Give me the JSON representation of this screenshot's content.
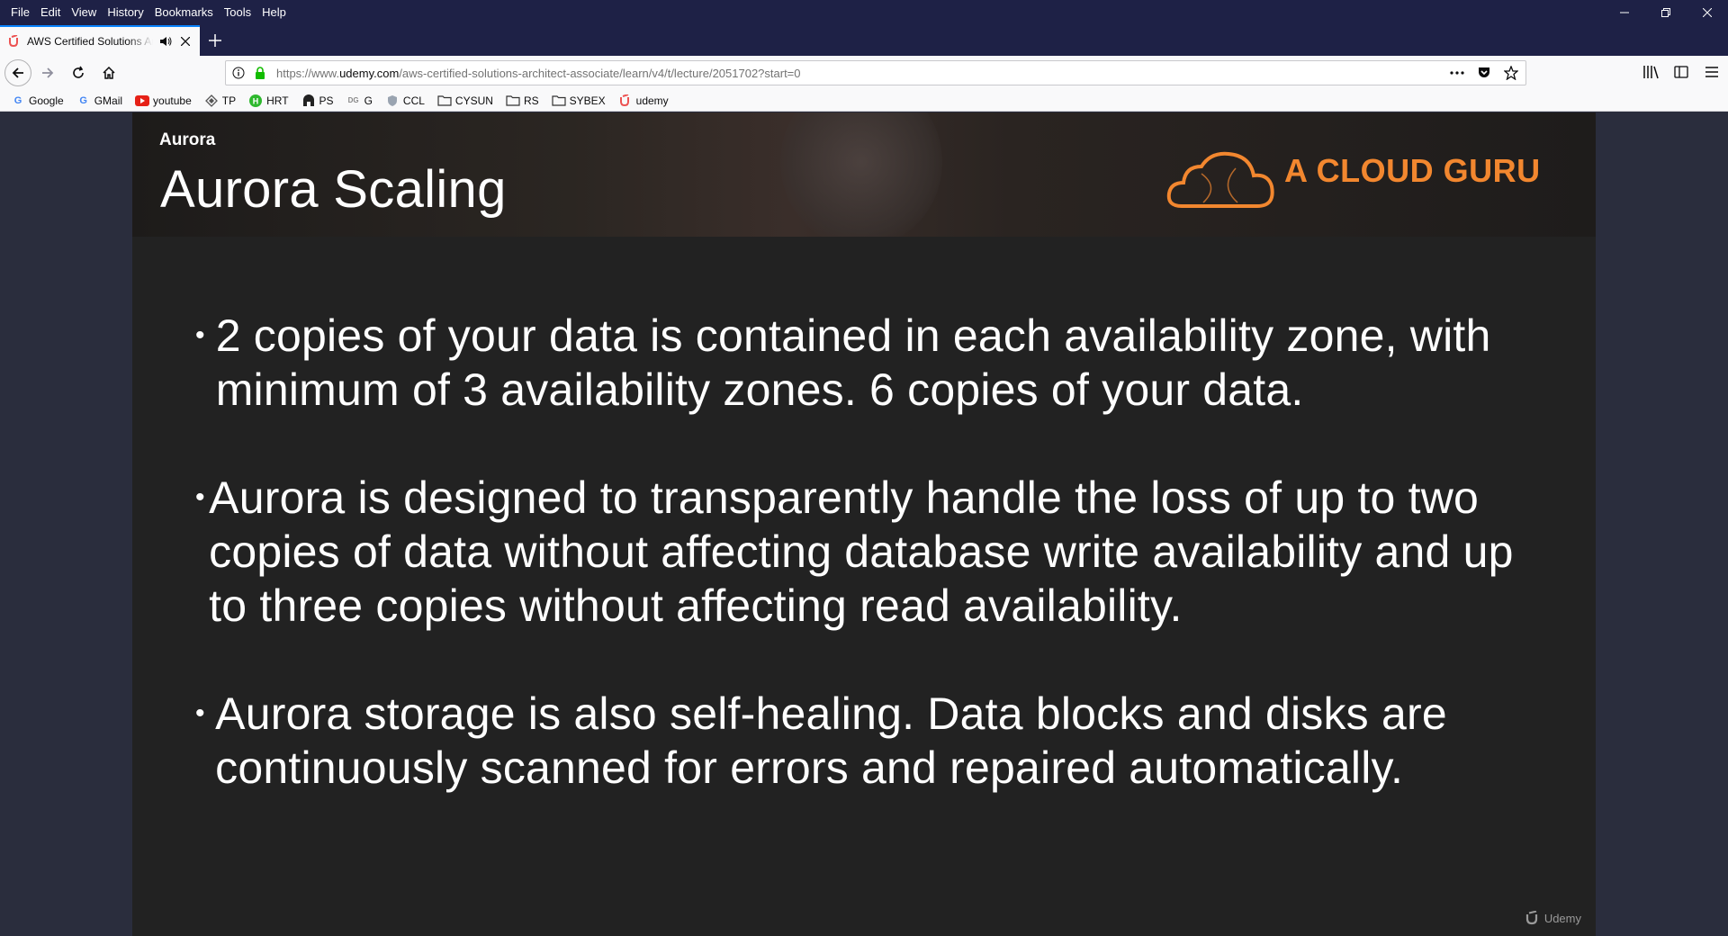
{
  "menu": [
    "File",
    "Edit",
    "View",
    "History",
    "Bookmarks",
    "Tools",
    "Help"
  ],
  "tab": {
    "title": "AWS Certified Solutions Architect - Associate",
    "favicon": "udemy-icon"
  },
  "address": {
    "scheme_prefix": "https://www.",
    "host": "udemy.com",
    "path": "/aws-certified-solutions-architect-associate/learn/v4/t/lecture/2051702?start=0"
  },
  "bookmarks": [
    {
      "label": "Google",
      "icon": "google-icon"
    },
    {
      "label": "GMail",
      "icon": "google-icon"
    },
    {
      "label": "youtube",
      "icon": "youtube-icon"
    },
    {
      "label": "TP",
      "icon": "tp-icon"
    },
    {
      "label": "HRT",
      "icon": "hrt-icon"
    },
    {
      "label": "PS",
      "icon": "ps-icon"
    },
    {
      "label": "G",
      "icon": "g-icon"
    },
    {
      "label": "CCL",
      "icon": "shield-icon"
    },
    {
      "label": "CYSUN",
      "icon": "folder-icon"
    },
    {
      "label": "RS",
      "icon": "folder-icon"
    },
    {
      "label": "SYBEX",
      "icon": "folder-icon"
    },
    {
      "label": "udemy",
      "icon": "udemy-icon"
    }
  ],
  "slide": {
    "section": "Aurora",
    "title": "Aurora Scaling",
    "brand": "A CLOUD GURU",
    "bullets": [
      "2 copies of your data is contained in each availability zone, with minimum of 3 availability zones. 6 copies of your data.",
      "Aurora is designed to transparently handle the loss of up to two copies of data without affecting database write availability and up to three copies without affecting read availability.",
      "Aurora storage is also self-healing. Data blocks and disks are continuously scanned for errors and repaired automatically."
    ],
    "watermark": "Udemy"
  },
  "colors": {
    "chrome_dark": "#1e2146",
    "accent_tab": "#0a84ff",
    "brand_orange": "#f2872f",
    "slide_bg": "#222222",
    "page_bg": "#2a2d3d"
  }
}
